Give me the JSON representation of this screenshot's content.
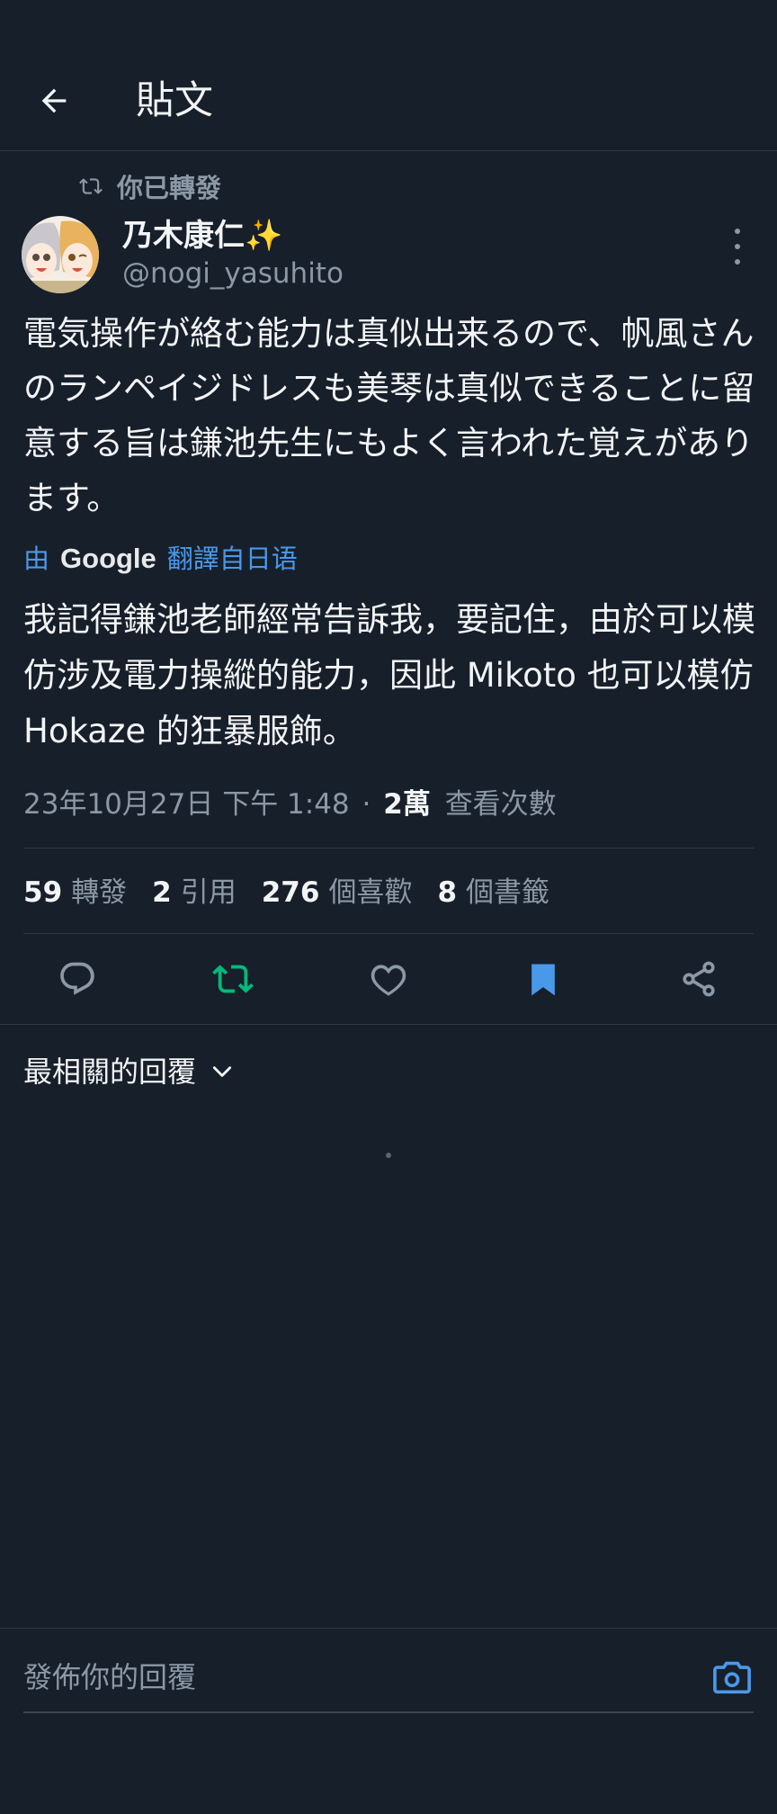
{
  "header": {
    "title": "貼文",
    "back_icon": "arrow-left-icon"
  },
  "retweet_indicator": {
    "label": "你已轉發",
    "icon": "retweet-icon"
  },
  "author": {
    "display_name": "乃木康仁✨",
    "handle": "@nogi_yasuhito",
    "avatar_icon": "avatar-illustration"
  },
  "tweet": {
    "text": "電気操作が絡む能力は真似出来るので、帆風さんのランペイジドレスも美琴は真似できることに留意する旨は鎌池先生にもよく言われた覚えがあります。",
    "translation_prefix": "由",
    "translation_provider": "Google",
    "translation_suffix": "翻譯自日语",
    "translated_text": "我記得鎌池老師經常告訴我，要記住，由於可以模仿涉及電力操縱的能力，因此 Mikoto 也可以模仿 Hokaze 的狂暴服飾。",
    "timestamp": "23年10月27日 下午 1:48",
    "separator": "·",
    "views_count": "2萬",
    "views_label": "查看次數"
  },
  "stats": {
    "retweets": {
      "value": "59",
      "label": "轉發"
    },
    "quotes": {
      "value": "2",
      "label": "引用"
    },
    "likes": {
      "value": "276",
      "label": "個喜歡"
    },
    "bookmarks": {
      "value": "8",
      "label": "個書籤"
    }
  },
  "actions": [
    {
      "name": "reply",
      "icon": "reply-icon",
      "color": "#8b98a5"
    },
    {
      "name": "retweet",
      "icon": "retweet-icon",
      "color": "#00ba7c",
      "active": true
    },
    {
      "name": "like",
      "icon": "heart-icon",
      "color": "#8b98a5"
    },
    {
      "name": "bookmark",
      "icon": "bookmark-icon",
      "color": "#4a99e9",
      "active": true
    },
    {
      "name": "share",
      "icon": "share-icon",
      "color": "#8b98a5"
    }
  ],
  "replies": {
    "sort_label": "最相關的回覆",
    "icon": "chevron-down-icon"
  },
  "composer": {
    "placeholder": "發佈你的回覆",
    "icon": "camera-icon"
  },
  "colors": {
    "background": "#171f2a",
    "accent": "#4a99e9",
    "retweet_green": "#00ba7c",
    "muted": "#8b98a5"
  }
}
